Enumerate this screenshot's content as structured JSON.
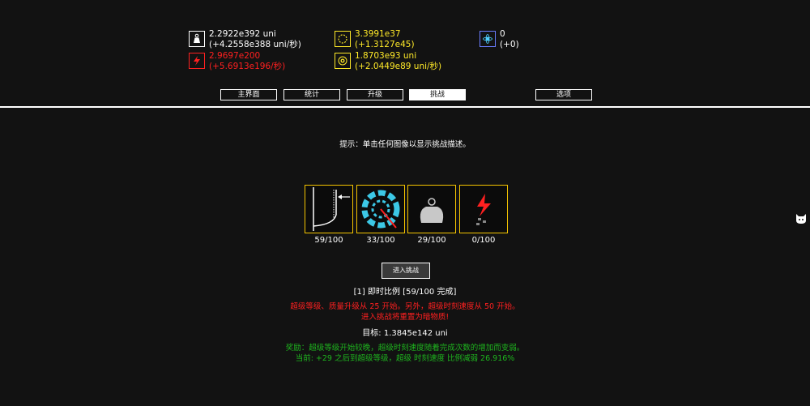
{
  "resources": {
    "mass": {
      "icon": "weight-icon",
      "value": "2.2922e392 uni",
      "rate": "(+4.2558e388 uni/秒)"
    },
    "dark_matter": {
      "icon": "lightning-icon",
      "value": "2.9697e200",
      "rate": "(+5.6913e196/秒)"
    },
    "rage": {
      "icon": "ring-icon",
      "value": "3.3991e37",
      "rate": "(+1.3127e45)"
    },
    "black_hole": {
      "icon": "black-hole-icon",
      "value": "1.8703e93 uni",
      "rate": "(+2.0449e89 uni/秒)"
    },
    "atom": {
      "icon": "atom-icon",
      "value": "0",
      "rate": "(+0)"
    }
  },
  "tabs": [
    {
      "label": "主界面",
      "active": false
    },
    {
      "label": "统计",
      "active": false
    },
    {
      "label": "升级",
      "active": false
    },
    {
      "label": "挑战",
      "active": true
    },
    {
      "label": "选项",
      "active": false
    }
  ],
  "hint": "提示：单击任何图像以显示挑战描述。",
  "challenges": [
    {
      "icon": "instant-scale-icon",
      "progress": "59/100"
    },
    {
      "icon": "tickspeed-icon",
      "progress": "33/100"
    },
    {
      "icon": "mass-weight-icon",
      "progress": "29/100"
    },
    {
      "icon": "dark-matter-icon",
      "progress": "0/100"
    }
  ],
  "enter_button": "进入挑战",
  "selected": {
    "title": "[1] 即时比例 [59/100 完成]",
    "desc_line1": "超级等级、质量升级从 25 开始。另外，超级时刻速度从 50 开始。",
    "desc_line2": "进入挑战将重置为暗物质!",
    "goal": "目标: 1.3845e142 uni",
    "reward_line1": "奖励：超级等级开始较晚，超级时刻速度随着完成次数的增加而变弱。",
    "reward_line2": "当前: +29 之后到超级等级，超级 时刻速度 比例减弱 26.916%"
  },
  "colors": {
    "background": "#121212",
    "mass_text": "#ffffff",
    "dark_matter_text": "#ff2020",
    "rage_text": "#ffea28",
    "challenge_border": "#f5c400",
    "description_red": "#ff2020",
    "reward_green": "#1eb41e"
  }
}
